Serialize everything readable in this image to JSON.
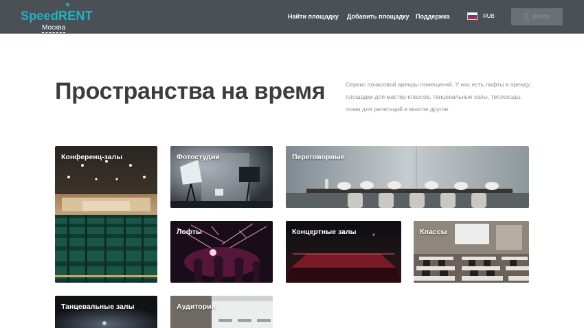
{
  "header": {
    "logo_text": "SpeedRENT",
    "city": "Москва",
    "nav": {
      "find": "Найти площадку",
      "add": "Добавить площадку",
      "support": "Поддержка"
    },
    "currency": "RUB",
    "login_label": "Войти"
  },
  "hero": {
    "title": "Пространства на время",
    "description": "Сервис почасовой аренды помещений. У нас есть лофты в аренду, площадки для мастер-классов, танцевальные залы, теплоходы, точки для репетиций и многое другое."
  },
  "categories": {
    "conference": "Конференц-залы",
    "photo": "Фотостудии",
    "meeting": "Переговорные",
    "lofts": "Лофты",
    "concert": "Концертные залы",
    "classes": "Классы",
    "dance": "Танцевальные залы",
    "auditoriums": "Аудитории"
  }
}
